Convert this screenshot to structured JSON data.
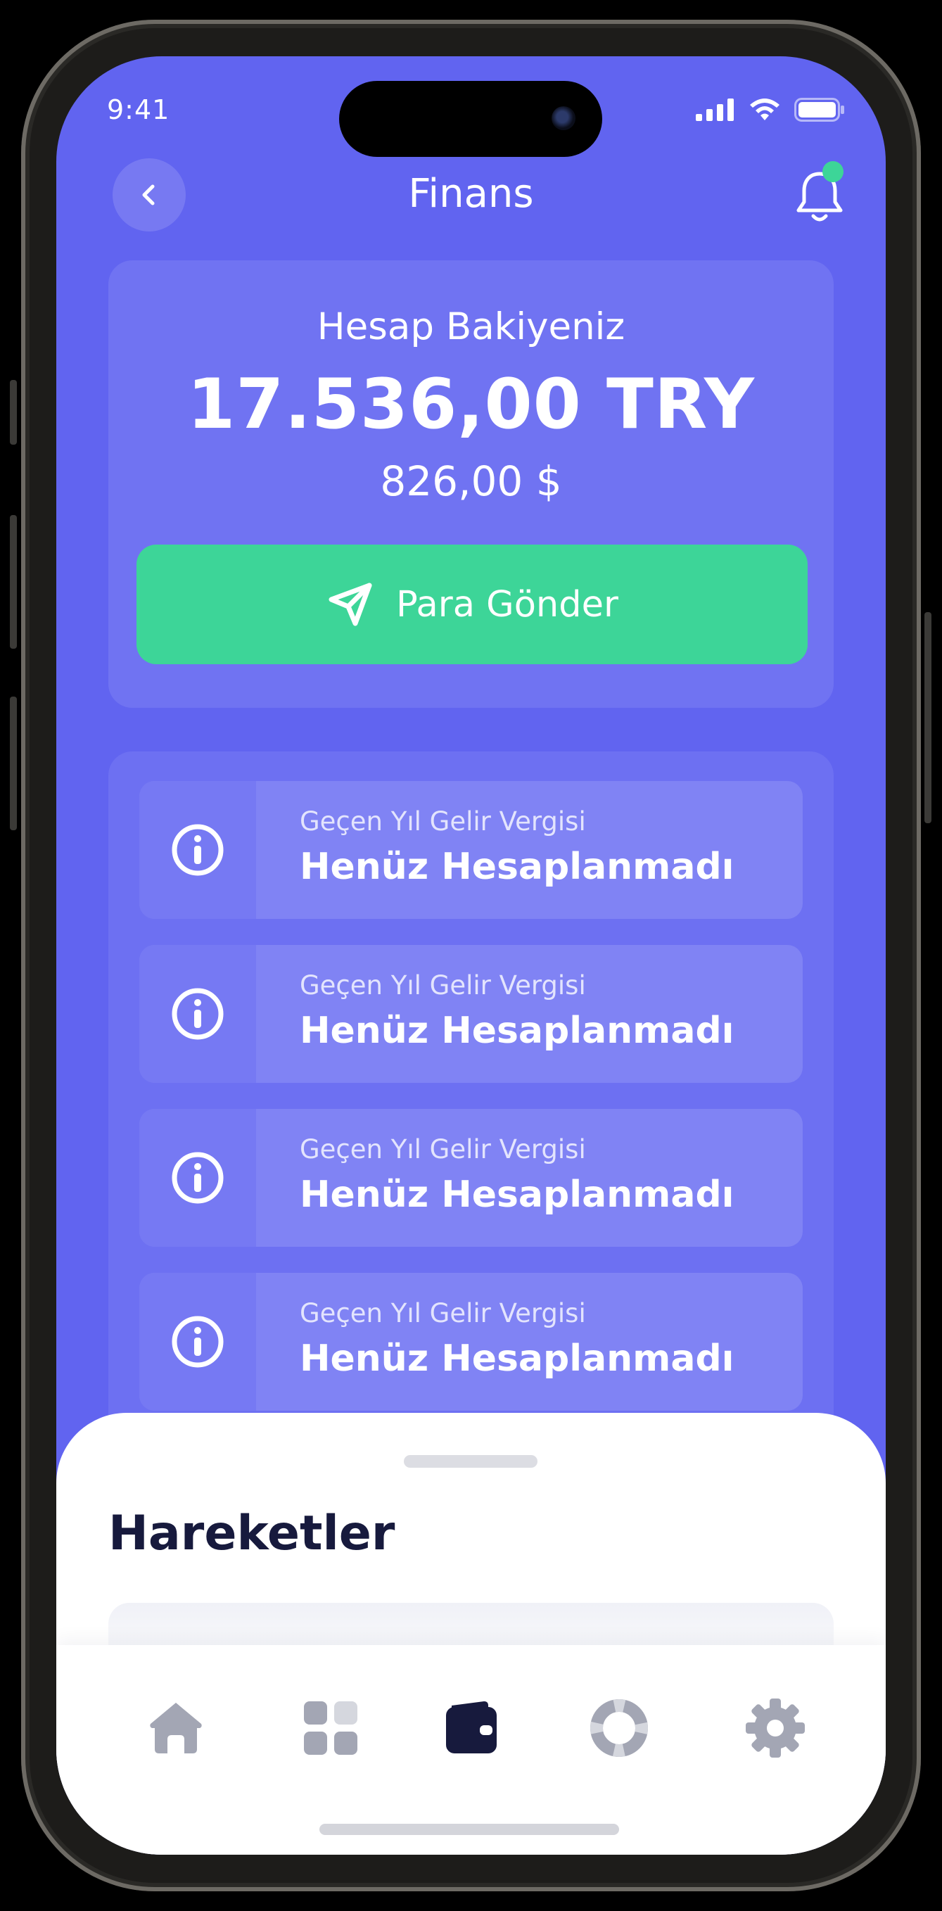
{
  "status_bar": {
    "time": "9:41"
  },
  "header": {
    "title": "Finans"
  },
  "balance": {
    "label": "Hesap Bakiyeniz",
    "amount": "17.536,00 TRY",
    "amount_usd": "826,00 $",
    "send_button_label": "Para Gönder"
  },
  "tax_items": [
    {
      "subtitle": "Geçen Yıl Gelir Vergisi",
      "value": "Henüz Hesaplanmadı"
    },
    {
      "subtitle": "Geçen Yıl Gelir Vergisi",
      "value": "Henüz Hesaplanmadı"
    },
    {
      "subtitle": "Geçen Yıl Gelir Vergisi",
      "value": "Henüz Hesaplanmadı"
    },
    {
      "subtitle": "Geçen Yıl Gelir Vergisi",
      "value": "Henüz Hesaplanmadı"
    }
  ],
  "sheet": {
    "title": "Hareketler"
  },
  "tab_bar": {
    "items": [
      {
        "icon": "home-icon",
        "active": false
      },
      {
        "icon": "grid-icon",
        "active": false
      },
      {
        "icon": "wallet-icon",
        "active": true
      },
      {
        "icon": "lifebuoy-icon",
        "active": false
      },
      {
        "icon": "gear-icon",
        "active": false
      }
    ]
  },
  "colors": {
    "background": "#6164F0",
    "accent_green": "#3DD598",
    "active_tab": "#171A3D",
    "inactive_tab": "#A3A6B4"
  }
}
